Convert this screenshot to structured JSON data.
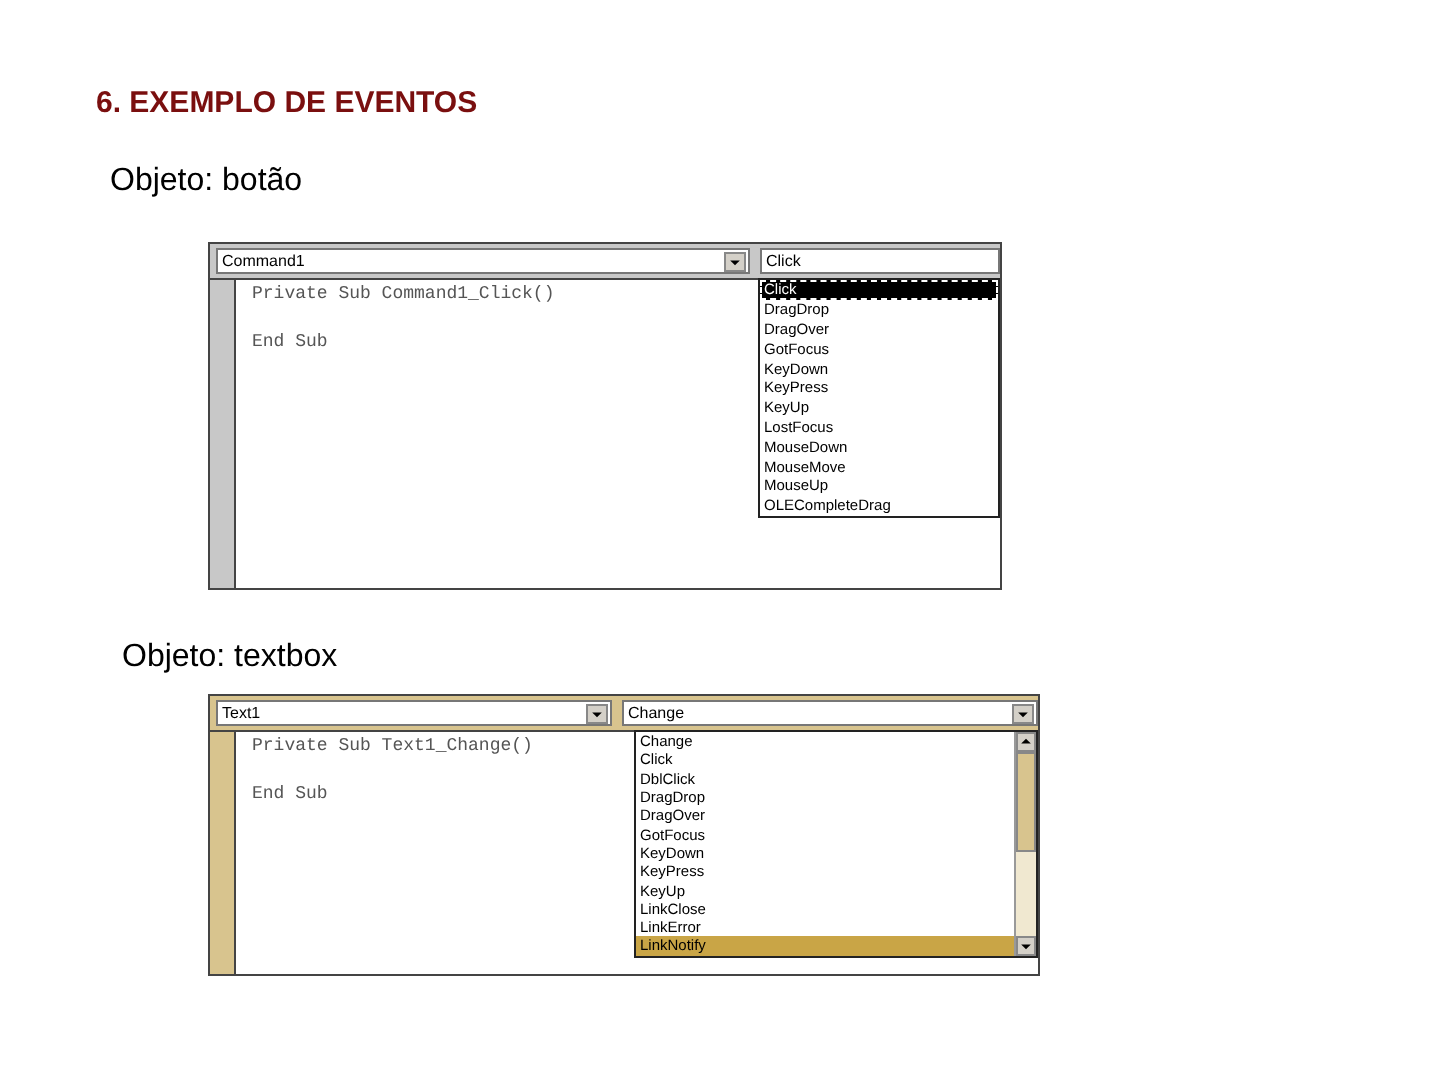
{
  "title": "6. EXEMPLO DE EVENTOS",
  "sections": [
    {
      "caption": "Objeto: botão",
      "editor": {
        "object_box": "Command1",
        "event_box": "Click",
        "code": [
          "Private Sub Command1_Click()",
          "End Sub"
        ],
        "events": [
          {
            "label": "Click",
            "selected": true
          },
          {
            "label": "DragDrop",
            "selected": false
          },
          {
            "label": "DragOver",
            "selected": false
          },
          {
            "label": "GotFocus",
            "selected": false
          },
          {
            "label": "KeyDown",
            "selected": false
          },
          {
            "label": "KeyPress",
            "selected": false
          },
          {
            "label": "KeyUp",
            "selected": false
          },
          {
            "label": "LostFocus",
            "selected": false
          },
          {
            "label": "MouseDown",
            "selected": false
          },
          {
            "label": "MouseMove",
            "selected": false
          },
          {
            "label": "MouseUp",
            "selected": false
          },
          {
            "label": "OLECompleteDrag",
            "selected": false
          }
        ]
      }
    },
    {
      "caption": "Objeto: textbox",
      "editor": {
        "object_box": "Text1",
        "event_box": "Change",
        "code": [
          "Private Sub Text1_Change()",
          "End Sub"
        ],
        "list_scrollbar": true,
        "events": [
          {
            "label": "Change",
            "selected": false
          },
          {
            "label": "Click",
            "selected": false
          },
          {
            "label": "DblClick",
            "selected": false
          },
          {
            "label": "DragDrop",
            "selected": false
          },
          {
            "label": "DragOver",
            "selected": false
          },
          {
            "label": "GotFocus",
            "selected": false
          },
          {
            "label": "KeyDown",
            "selected": false
          },
          {
            "label": "KeyPress",
            "selected": false
          },
          {
            "label": "KeyUp",
            "selected": false
          },
          {
            "label": "LinkClose",
            "selected": false
          },
          {
            "label": "LinkError",
            "selected": false
          },
          {
            "label": "LinkNotify",
            "selected": true
          }
        ]
      }
    }
  ]
}
